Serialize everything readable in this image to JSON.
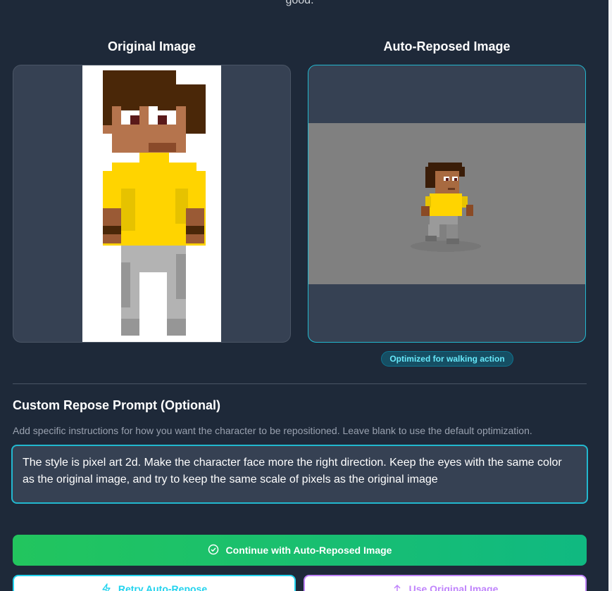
{
  "header": {
    "top_text": "good."
  },
  "original": {
    "title": "Original Image"
  },
  "reposed": {
    "title": "Auto-Reposed Image",
    "badge": "Optimized for walking action"
  },
  "custom_prompt": {
    "title": "Custom Repose Prompt (Optional)",
    "description": "Add specific instructions for how you want the character to be repositioned. Leave blank to use the default optimization.",
    "value": "The style is pixel art 2d. Make the character face more the right direction. Keep the eyes with the same color as the original image, and try to keep the same scale of pixels as the original image"
  },
  "actions": {
    "continue_label": "Continue with Auto-Reposed Image",
    "retry_label": "Retry Auto-Repose",
    "use_original_label": "Use Original Image"
  },
  "icons": {
    "continue": "check-circle-icon",
    "retry": "lightning-icon",
    "use_original": "upload-icon"
  },
  "colors": {
    "background": "#1e2939",
    "panel": "#364153",
    "accent_cyan": "#22b8cf",
    "accent_green": "#22c55e",
    "accent_purple": "#c084fc"
  }
}
